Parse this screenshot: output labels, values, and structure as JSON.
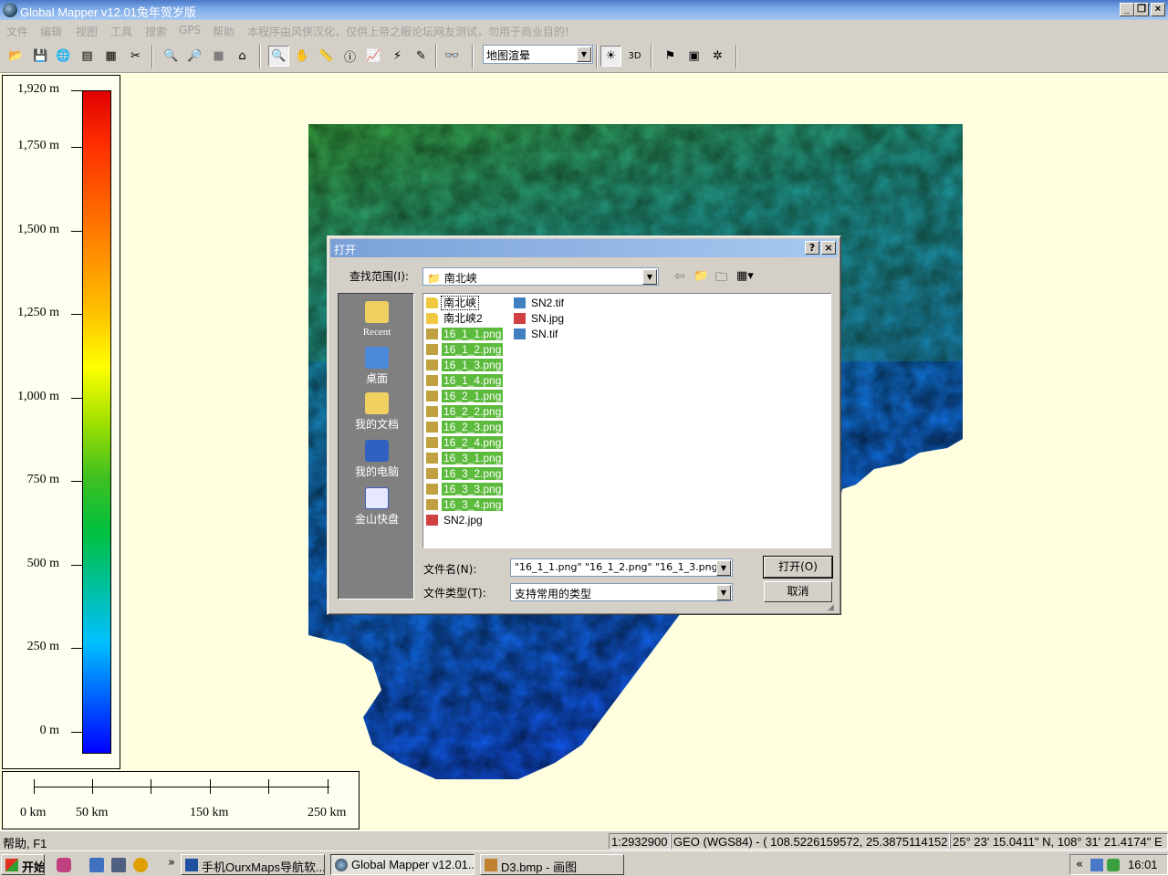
{
  "window": {
    "title": "Global Mapper v12.01兔年贺岁版"
  },
  "menu": [
    "文件",
    "编辑",
    "视图",
    "工具",
    "搜索",
    "GPS",
    "帮助",
    "本程序由风侠汉化，仅供上帝之眼论坛网友测试，勿用于商业目的!"
  ],
  "toolbar": {
    "render_mode": "地图渲晕",
    "icons": [
      "open-folder",
      "save",
      "globe",
      "layers",
      "config",
      "tools",
      "zoom-in",
      "zoom-out",
      "full-view",
      "home",
      "zoom-tool",
      "pan-hand",
      "measure",
      "info-globe",
      "path-profile",
      "tower",
      "draw-line",
      "binoculars",
      "shader",
      "3d-view",
      "digitize",
      "layers-2",
      "feature"
    ]
  },
  "legend": {
    "labels": [
      "1,920 m",
      "1,750 m",
      "1,500 m",
      "1,250 m",
      "1,000 m",
      "750 m",
      "500 m",
      "250 m",
      "0 m"
    ],
    "label_values": [
      1920,
      1750,
      1500,
      1250,
      1000,
      750,
      500,
      250,
      0
    ]
  },
  "scalebar": {
    "labels": [
      "0 km",
      "50 km",
      "150 km",
      "250 km"
    ]
  },
  "dialog": {
    "title": "打开",
    "look_in_label": "查找范围(I):",
    "look_in_value": "南北峡",
    "places": [
      "Recent",
      "桌面",
      "我的文档",
      "我的电脑",
      "金山快盘"
    ],
    "files_col1": [
      {
        "name": "南北峡",
        "type": "folder",
        "selected": false
      },
      {
        "name": "南北峡2",
        "type": "folder",
        "selected": false
      },
      {
        "name": "16_1_1.png",
        "type": "png",
        "selected": true
      },
      {
        "name": "16_1_2.png",
        "type": "png",
        "selected": true
      },
      {
        "name": "16_1_3.png",
        "type": "png",
        "selected": true
      },
      {
        "name": "16_1_4.png",
        "type": "png",
        "selected": true
      },
      {
        "name": "16_2_1.png",
        "type": "png",
        "selected": true
      },
      {
        "name": "16_2_2.png",
        "type": "png",
        "selected": true
      },
      {
        "name": "16_2_3.png",
        "type": "png",
        "selected": true
      },
      {
        "name": "16_2_4.png",
        "type": "png",
        "selected": true
      },
      {
        "name": "16_3_1.png",
        "type": "png",
        "selected": true
      },
      {
        "name": "16_3_2.png",
        "type": "png",
        "selected": true
      },
      {
        "name": "16_3_3.png",
        "type": "png",
        "selected": true
      },
      {
        "name": "16_3_4.png",
        "type": "png",
        "selected": true
      },
      {
        "name": "SN2.jpg",
        "type": "jpg",
        "selected": false
      }
    ],
    "files_col2": [
      {
        "name": "SN2.tif",
        "type": "tif",
        "selected": false
      },
      {
        "name": "SN.jpg",
        "type": "jpg",
        "selected": false
      },
      {
        "name": "SN.tif",
        "type": "tif",
        "selected": false
      }
    ],
    "filename_label": "文件名(N):",
    "filename_value": "\"16_1_1.png\" \"16_1_2.png\" \"16_1_3.png\"",
    "filetype_label": "文件类型(T):",
    "filetype_value": "支持常用的类型",
    "open_button": "打开(O)",
    "cancel_button": "取消",
    "help_button": "?",
    "close_button": "×"
  },
  "status": {
    "help": "帮助, F1",
    "scale": "1:2932900",
    "projection": "GEO (WGS84) - ( 108.5226159572, 25.3875114152 )",
    "dms": "25° 23' 15.0411\" N, 108° 31' 21.4174\" E"
  },
  "taskbar": {
    "start": "开始",
    "tasks": [
      "手机OurxMaps导航软...",
      "Global Mapper v12.01...",
      "D3.bmp - 画图"
    ],
    "more": "»",
    "tray_more": "«",
    "clock": "16:01"
  },
  "colors": {
    "selection": "#5cba3c",
    "map_background": "#ffffe0",
    "legend_ramp": [
      "#e00000",
      "#ff3000",
      "#ff6000",
      "#ff9000",
      "#ffc000",
      "#ffff00",
      "#a0e000",
      "#40c020",
      "#00c040",
      "#00c0a0",
      "#00c0ff",
      "#0060ff",
      "#0000ff"
    ]
  }
}
